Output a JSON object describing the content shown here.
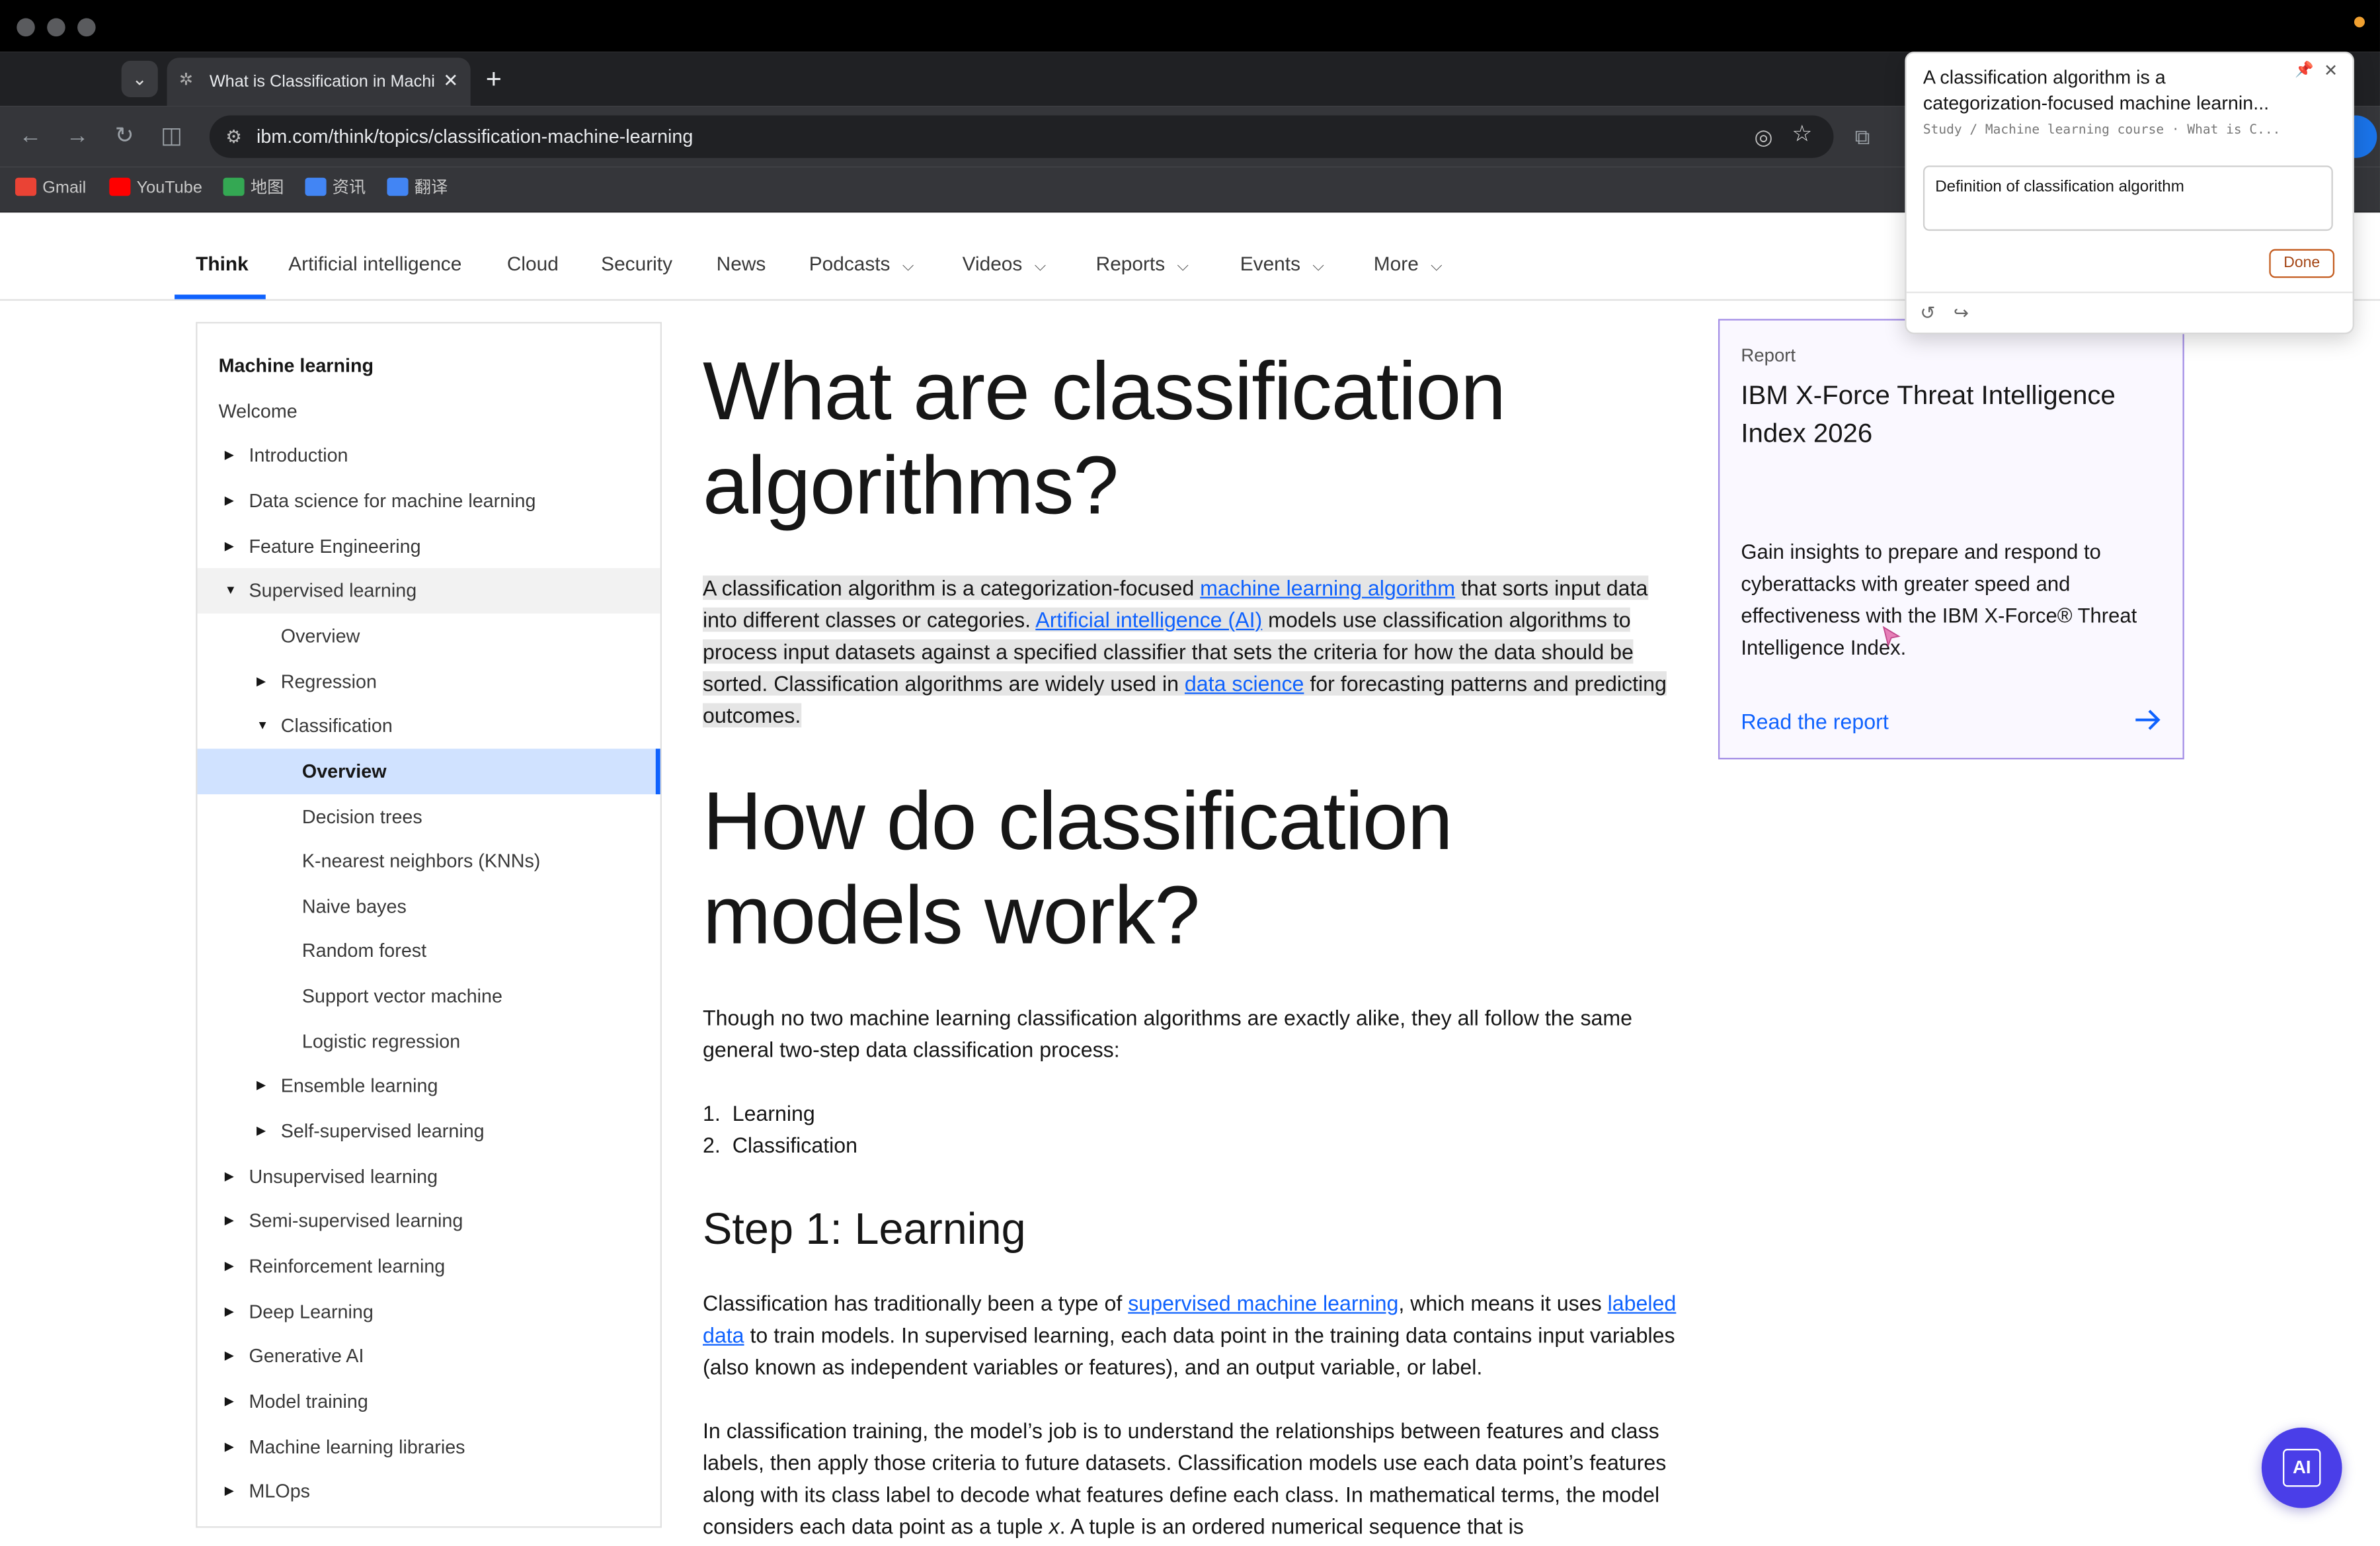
{
  "browser": {
    "tab_title": "What is Classification in Machine Learning | IBM",
    "tab_close": "✕",
    "new_tab": "+",
    "url": "ibm.com/think/topics/classification-machine-learning",
    "bookmarks": [
      {
        "label": "Gmail",
        "icon": "gmail-icon",
        "color": "#ea4335"
      },
      {
        "label": "YouTube",
        "icon": "youtube-icon",
        "color": "#ff0000"
      },
      {
        "label": "地图",
        "icon": "maps-icon",
        "color": "#34a853"
      },
      {
        "label": "资讯",
        "icon": "news-icon",
        "color": "#4285f4"
      },
      {
        "label": "翻译",
        "icon": "translate-icon",
        "color": "#4285f4"
      }
    ]
  },
  "site_nav": {
    "items": [
      {
        "label": "Think",
        "dropdown": false,
        "active": true
      },
      {
        "label": "Artificial intelligence",
        "dropdown": false
      },
      {
        "label": "Cloud",
        "dropdown": false
      },
      {
        "label": "Security",
        "dropdown": false
      },
      {
        "label": "News",
        "dropdown": false
      },
      {
        "label": "Podcasts",
        "dropdown": true
      },
      {
        "label": "Videos",
        "dropdown": true
      },
      {
        "label": "Reports",
        "dropdown": true
      },
      {
        "label": "Events",
        "dropdown": true
      },
      {
        "label": "More",
        "dropdown": true
      }
    ]
  },
  "sidebar": {
    "items": [
      {
        "label": "Machine learning",
        "level": 0,
        "arrow": "",
        "style": "bold"
      },
      {
        "label": "Welcome",
        "level": 0,
        "arrow": ""
      },
      {
        "label": "Introduction",
        "level": 1,
        "arrow": "right"
      },
      {
        "label": "Data science for machine learning",
        "level": 1,
        "arrow": "right"
      },
      {
        "label": "Feature Engineering",
        "level": 1,
        "arrow": "right"
      },
      {
        "label": "Supervised learning",
        "level": 1,
        "arrow": "down",
        "style": "hl"
      },
      {
        "label": "Overview",
        "level": 2,
        "arrow": ""
      },
      {
        "label": "Regression",
        "level": 2,
        "arrow": "right"
      },
      {
        "label": "Classification",
        "level": 2,
        "arrow": "down"
      },
      {
        "label": "Overview",
        "level": 3,
        "arrow": "",
        "style": "sel"
      },
      {
        "label": "Decision trees",
        "level": 3,
        "arrow": ""
      },
      {
        "label": "K-nearest neighbors (KNNs)",
        "level": 3,
        "arrow": ""
      },
      {
        "label": "Naive bayes",
        "level": 3,
        "arrow": ""
      },
      {
        "label": "Random forest",
        "level": 3,
        "arrow": ""
      },
      {
        "label": "Support vector machine",
        "level": 3,
        "arrow": ""
      },
      {
        "label": "Logistic regression",
        "level": 3,
        "arrow": ""
      },
      {
        "label": "Ensemble learning",
        "level": 2,
        "arrow": "right"
      },
      {
        "label": "Self-supervised learning",
        "level": 2,
        "arrow": "right"
      },
      {
        "label": "Unsupervised learning",
        "level": 1,
        "arrow": "right"
      },
      {
        "label": "Semi-supervised learning",
        "level": 1,
        "arrow": "right"
      },
      {
        "label": "Reinforcement learning",
        "level": 1,
        "arrow": "right"
      },
      {
        "label": "Deep Learning",
        "level": 1,
        "arrow": "right"
      },
      {
        "label": "Generative AI",
        "level": 1,
        "arrow": "right"
      },
      {
        "label": "Model training",
        "level": 1,
        "arrow": "right"
      },
      {
        "label": "Machine learning libraries",
        "level": 1,
        "arrow": "right"
      },
      {
        "label": "MLOps",
        "level": 1,
        "arrow": "right"
      }
    ]
  },
  "article": {
    "h1_line1": "What are classification",
    "h1_line2": "algorithms?",
    "p1_a": "A classification algorithm is a categorization-focused ",
    "p1_link1": "machine learning algorithm",
    "p1_b": " that sorts input data into different classes or categories. ",
    "p1_link2": "Artificial intelligence (AI)",
    "p1_c": " models use classification algorithms to process input datasets against a specified classifier that sets the criteria for how the data should be sorted. Classification algorithms are widely used in ",
    "p1_link3": "data science",
    "p1_d": " for forecasting patterns and predicting outcomes.",
    "h1b_line1": "How do classification",
    "h1b_line2": "models work?",
    "p2": "Though no two machine learning classification algorithms are exactly alike, they all follow the same general two-step data classification process:",
    "list": [
      {
        "num": "1.",
        "text": "Learning"
      },
      {
        "num": "2.",
        "text": "Classification"
      }
    ],
    "h2": "Step 1: Learning",
    "p3_a": "Classification has traditionally been a type of ",
    "p3_link1": "supervised machine learning",
    "p3_b": ", which means it uses ",
    "p3_link2": "labeled data",
    "p3_c": " to train models. In supervised learning, each data point in the training data contains input variables (also known as independent variables or features), and an output variable, or label.",
    "p4_a": "In classification training, the model’s job is to understand the relationships between features and class labels, then apply those criteria to future datasets. Classification models use each data point’s features along with its class label to decode what features define each class. In mathematical terms, the model considers each data point as a tuple ",
    "p4_x": "x",
    "p4_b": ". A tuple is an ordered numerical sequence that is"
  },
  "report_card": {
    "tag": "Report",
    "title": "IBM X-Force Threat Intelligence Index 2026",
    "description": "Gain insights to prepare and respond to cyberattacks with greater speed and effectiveness with the IBM X-Force® Threat Intelligence Index.",
    "link": "Read the report"
  },
  "popup": {
    "title": "A classification algorithm is a categorization-focused machine learnin...",
    "path": "Study / Machine learning course · What is C...",
    "note_value": "Definition of classification algorithm",
    "done_label": "Done"
  },
  "ai_button": {
    "label": "AI"
  },
  "colors": {
    "accent": "#0f62fe",
    "card_border": "#a48fe6",
    "ai_button": "#4a3ee8",
    "done_border": "#c35b1e"
  }
}
